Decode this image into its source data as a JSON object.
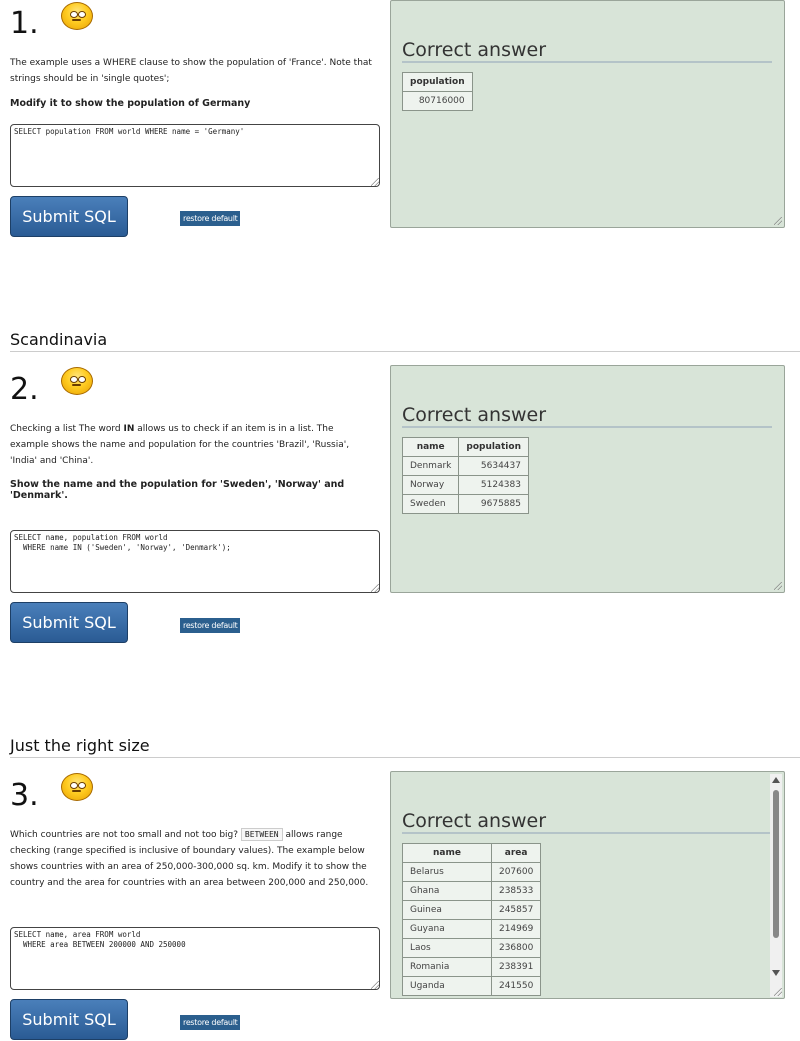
{
  "questions": [
    {
      "number": "1.",
      "description": "The example uses a WHERE clause to show the population of 'France'. Note that strings should be in 'single quotes';",
      "task": "Modify it to show the population of Germany",
      "sql": "SELECT population FROM world WHERE name = 'Germany'",
      "submit_label": "Submit SQL",
      "restore_label": "restore default",
      "answer_title": "Correct answer",
      "columns": [
        "population"
      ],
      "rows": [
        [
          "80716000"
        ]
      ]
    },
    {
      "section": "Scandinavia",
      "number": "2.",
      "description_pre": "Checking a list The word ",
      "description_keyword": "IN",
      "description_post": " allows us to check if an item is in a list. The example shows the name and population for the countries 'Brazil', 'Russia', 'India' and 'China'.",
      "task": "Show the name and the population for 'Sweden', 'Norway' and 'Denmark'.",
      "sql": "SELECT name, population FROM world\n  WHERE name IN ('Sweden', 'Norway', 'Denmark');",
      "submit_label": "Submit SQL",
      "restore_label": "restore default",
      "answer_title": "Correct answer",
      "columns": [
        "name",
        "population"
      ],
      "rows": [
        [
          "Denmark",
          "5634437"
        ],
        [
          "Norway",
          "5124383"
        ],
        [
          "Sweden",
          "9675885"
        ]
      ]
    },
    {
      "section": "Just the right size",
      "number": "3.",
      "description_pre": "Which countries are not too small and not too big? ",
      "description_keyword": "BETWEEN",
      "description_post": " allows range checking (range specified is inclusive of boundary values). The example below shows countries with an area of 250,000-300,000 sq. km. Modify it to show the country and the area for countries with an area between 200,000 and 250,000.",
      "sql": "SELECT name, area FROM world\n  WHERE area BETWEEN 200000 AND 250000",
      "submit_label": "Submit SQL",
      "restore_label": "restore default",
      "answer_title": "Correct answer",
      "columns": [
        "name",
        "area"
      ],
      "rows": [
        [
          "Belarus",
          "207600"
        ],
        [
          "Ghana",
          "238533"
        ],
        [
          "Guinea",
          "245857"
        ],
        [
          "Guyana",
          "214969"
        ],
        [
          "Laos",
          "236800"
        ],
        [
          "Romania",
          "238391"
        ],
        [
          "Uganda",
          "241550"
        ]
      ]
    }
  ]
}
